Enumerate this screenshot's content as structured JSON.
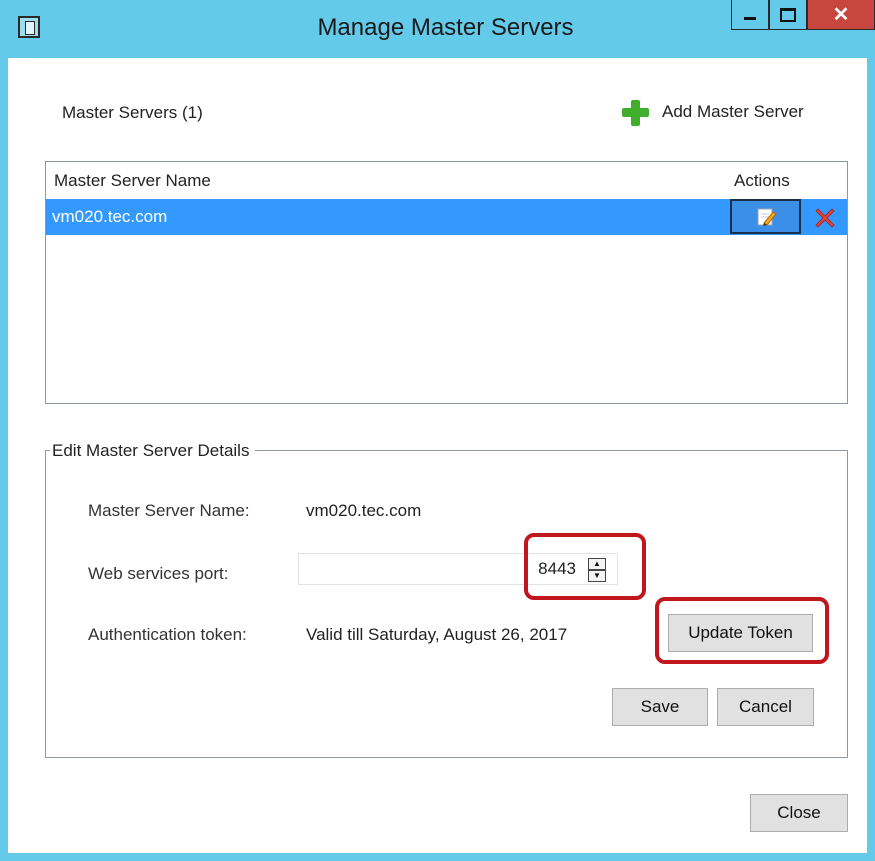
{
  "window": {
    "title": "Manage Master Servers"
  },
  "servers_section": {
    "count_label": "Master Servers (1)",
    "add_label": "Add Master Server"
  },
  "table": {
    "columns": [
      "Master Server Name",
      "Actions"
    ],
    "rows": [
      {
        "name": "vm020.tec.com"
      }
    ]
  },
  "details": {
    "legend": "Edit Master Server Details",
    "name_label": "Master Server Name:",
    "name_value": "vm020.tec.com",
    "port_label": "Web services port:",
    "port_value": "8443",
    "token_label": "Authentication token:",
    "token_value": "Valid till Saturday, August 26, 2017",
    "update_token_label": "Update Token",
    "save_label": "Save",
    "cancel_label": "Cancel"
  },
  "footer": {
    "close_label": "Close"
  },
  "colors": {
    "titlebar": "#63cae9",
    "selection": "#3399ff",
    "highlight": "#c0171d",
    "close_button": "#c7463d"
  },
  "icons": {
    "app": "window-icon",
    "add": "plus-icon",
    "edit": "edit-icon",
    "delete": "delete-x-icon"
  }
}
